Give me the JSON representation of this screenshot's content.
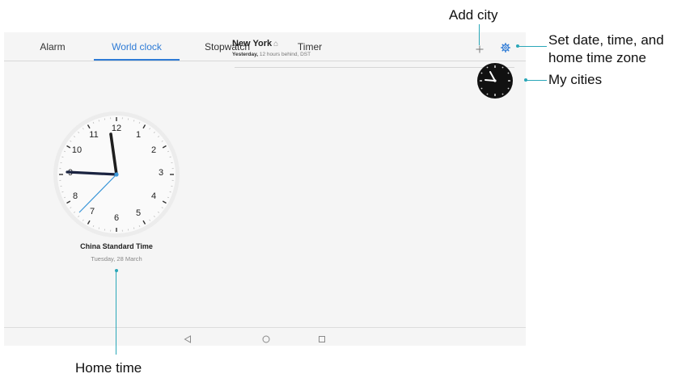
{
  "tabs": [
    {
      "label": "Alarm",
      "active": false
    },
    {
      "label": "World clock",
      "active": true
    },
    {
      "label": "Stopwatch",
      "active": false
    },
    {
      "label": "Timer",
      "active": false
    }
  ],
  "toolbar": {
    "add_icon": "plus-icon",
    "settings_icon": "gear-icon"
  },
  "cities": [
    {
      "name": "New York",
      "home_marker_icon": "home-icon",
      "day": "Yesterday,",
      "offset": "12 hours behind, DST",
      "clock_face": "dark"
    }
  ],
  "home_clock": {
    "numerals": [
      "12",
      "1",
      "2",
      "3",
      "4",
      "5",
      "6",
      "7",
      "8",
      "9",
      "10",
      "11"
    ],
    "timezone": "China Standard Time",
    "date": "Tuesday, 28 March"
  },
  "navbar": {
    "back_icon": "back-triangle-icon",
    "home_icon": "home-circle-icon",
    "recents_icon": "recents-square-icon"
  },
  "annotations": {
    "add_city": "Add city",
    "settings_line1": "Set date, time, and",
    "settings_line2": "home time zone",
    "my_cities": "My cities",
    "home_time": "Home time"
  },
  "colors": {
    "accent": "#2e7bd6",
    "annotation_line": "#2aa7b8",
    "hour_hand": "#1e1e1e",
    "minute_hand": "#1a2340",
    "second_hand": "#3a96d8"
  }
}
